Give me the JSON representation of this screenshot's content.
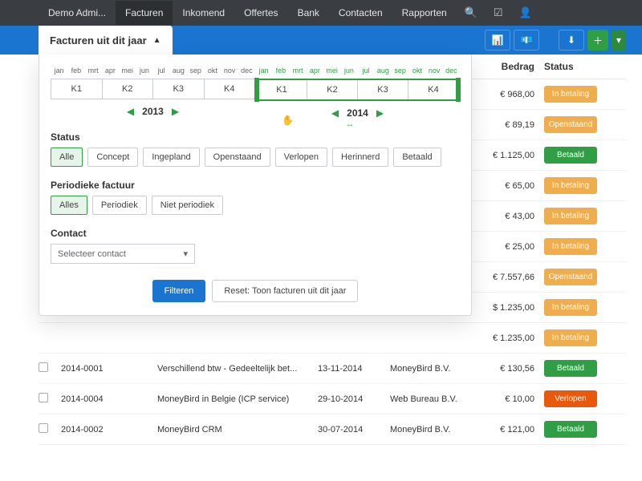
{
  "topnav": {
    "items": [
      "Demo Admi...",
      "Facturen",
      "Inkomend",
      "Offertes",
      "Bank",
      "Contacten",
      "Rapporten"
    ],
    "active": 1
  },
  "filter_tab": "Facturen uit dit jaar",
  "months": [
    "jan",
    "feb",
    "mrt",
    "apr",
    "mei",
    "jun",
    "jul",
    "aug",
    "sep",
    "okt",
    "nov",
    "dec"
  ],
  "quarters": [
    "K1",
    "K2",
    "K3",
    "K4"
  ],
  "years": {
    "prev": "2013",
    "current": "2014"
  },
  "status": {
    "label": "Status",
    "options": [
      "Alle",
      "Concept",
      "Ingepland",
      "Openstaand",
      "Verlopen",
      "Herinnerd",
      "Betaald"
    ],
    "active": 0
  },
  "periodic": {
    "label": "Periodieke factuur",
    "options": [
      "Alles",
      "Periodiek",
      "Niet periodiek"
    ],
    "active": 0
  },
  "contact": {
    "label": "Contact",
    "placeholder": "Selecteer contact"
  },
  "actions": {
    "filter": "Filteren",
    "reset": "Reset: Toon facturen uit dit jaar"
  },
  "table": {
    "headers": {
      "amount": "Bedrag",
      "status": "Status"
    },
    "rows": [
      {
        "amount": "€ 968,00",
        "status": "In betaling",
        "cls": "bet"
      },
      {
        "amount": "€ 89,19",
        "status": "Openstaand",
        "cls": "open"
      },
      {
        "amount": "€ 1.125,00",
        "status": "Betaald",
        "cls": "paid"
      },
      {
        "amount": "€ 65,00",
        "status": "In betaling",
        "cls": "bet"
      },
      {
        "amount": "€ 43,00",
        "status": "In betaling",
        "cls": "bet"
      },
      {
        "amount": "€ 25,00",
        "status": "In betaling",
        "cls": "bet"
      },
      {
        "amount": "€ 7.557,66",
        "status": "Openstaand",
        "cls": "open"
      },
      {
        "amount": "$ 1.235,00",
        "status": "In betaling",
        "cls": "bet"
      },
      {
        "amount": "€ 1.235,00",
        "status": "In betaling",
        "cls": "bet"
      },
      {
        "num": "2014-0001",
        "desc": "Verschillend btw - Gedeeltelijk bet...",
        "date": "13-11-2014",
        "cust": "MoneyBird B.V.",
        "amount": "€ 130,56",
        "status": "Betaald",
        "cls": "paid"
      },
      {
        "num": "2014-0004",
        "desc": "MoneyBird in Belgie (ICP service)",
        "date": "29-10-2014",
        "cust": "Web Bureau B.V.",
        "amount": "€ 10,00",
        "status": "Verlopen",
        "cls": "verl"
      },
      {
        "num": "2014-0002",
        "desc": "MoneyBird CRM",
        "date": "30-07-2014",
        "cust": "MoneyBird B.V.",
        "amount": "€ 121,00",
        "status": "Betaald",
        "cls": "paid"
      }
    ]
  }
}
